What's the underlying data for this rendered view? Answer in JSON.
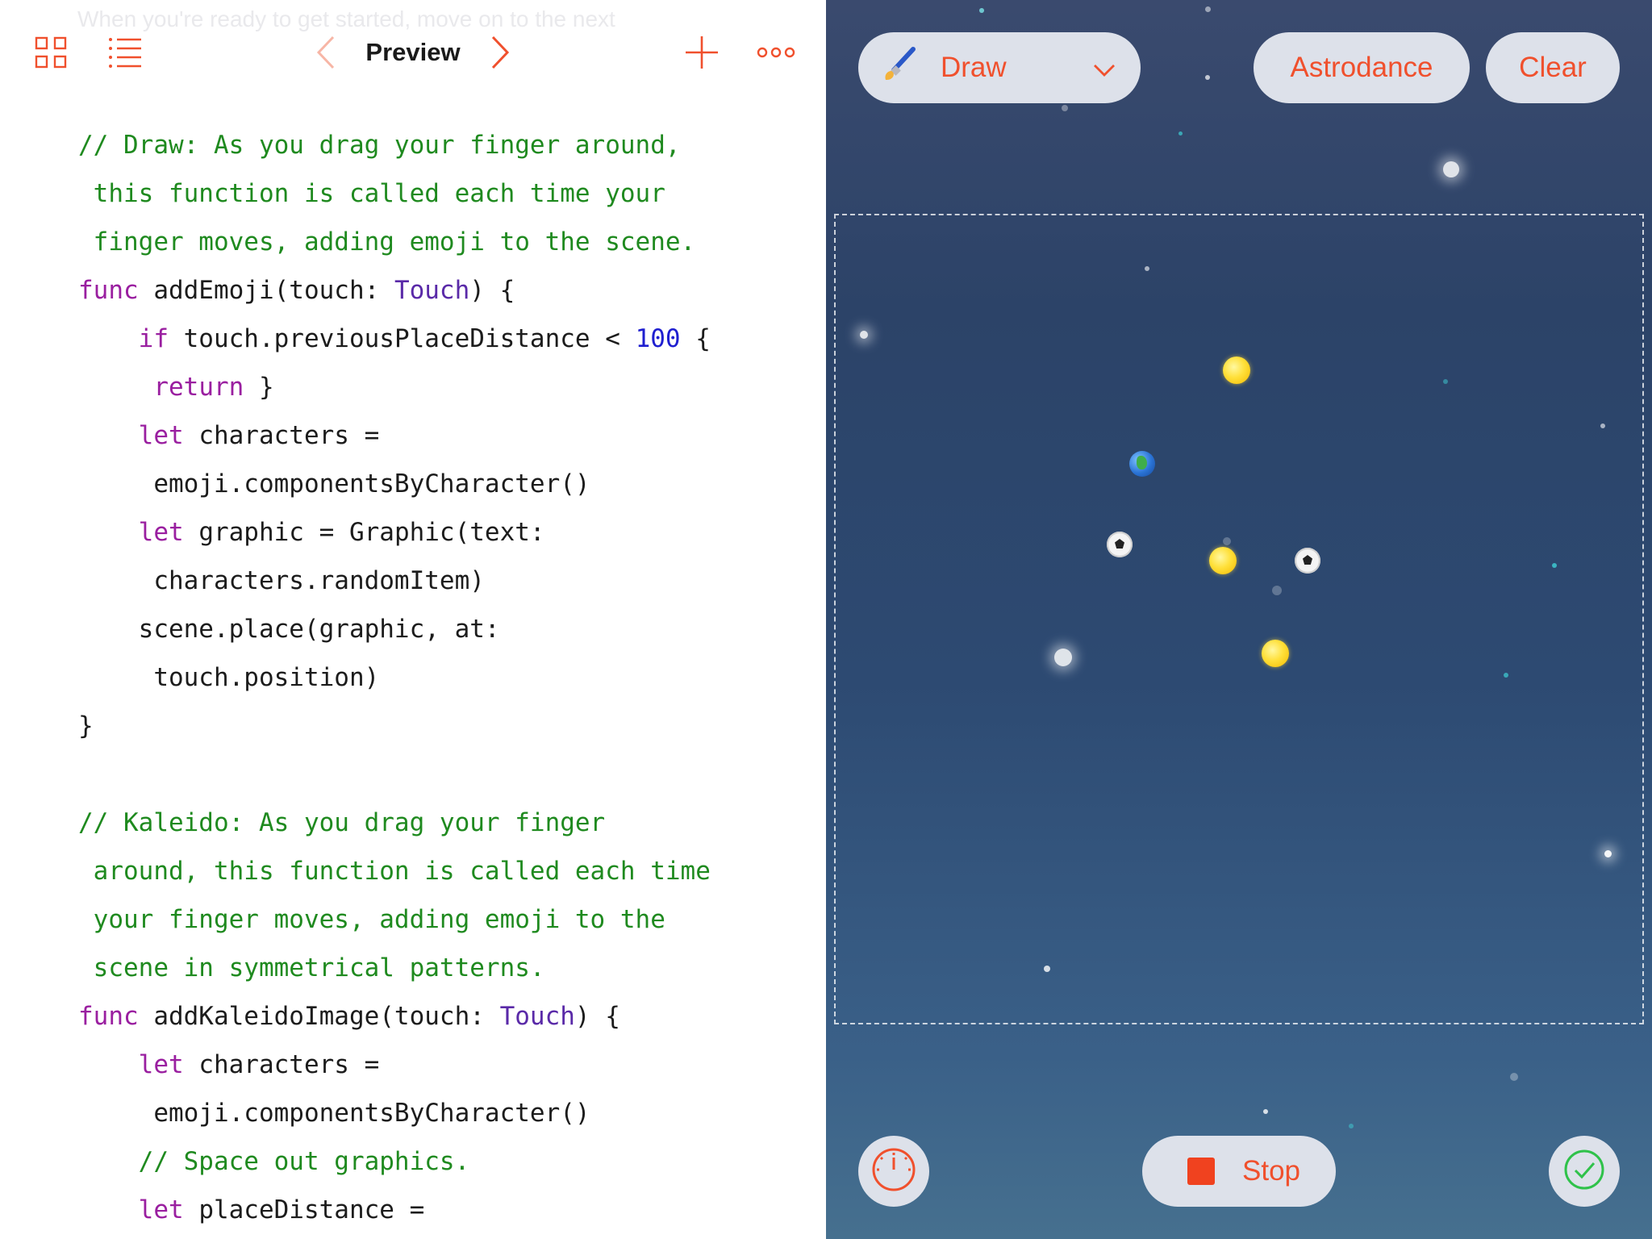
{
  "editor": {
    "faded_prose": "When you're ready to get started, move on to the next",
    "toolbar": {
      "title": "Preview",
      "icons": [
        "grid-icon",
        "list-icon",
        "chevron-left-icon",
        "chevron-right-icon",
        "plus-icon",
        "more-icon"
      ]
    },
    "code_lines": [
      [
        {
          "t": "// Draw: As you drag your finger around,",
          "c": "cm"
        }
      ],
      [
        {
          "t": " this function is called each time your",
          "c": "cm"
        }
      ],
      [
        {
          "t": " finger moves, adding emoji to the scene.",
          "c": "cm"
        }
      ],
      [
        {
          "t": "func",
          "c": "kw"
        },
        {
          "t": " addEmoji(touch: ",
          "c": ""
        },
        {
          "t": "Touch",
          "c": "ty"
        },
        {
          "t": ") {",
          "c": ""
        }
      ],
      [
        {
          "t": "    ",
          "c": ""
        },
        {
          "t": "if",
          "c": "kw"
        },
        {
          "t": " touch.previousPlaceDistance < ",
          "c": ""
        },
        {
          "t": "100",
          "c": "nm"
        },
        {
          "t": " {",
          "c": ""
        }
      ],
      [
        {
          "t": "     ",
          "c": ""
        },
        {
          "t": "return",
          "c": "kw"
        },
        {
          "t": " }",
          "c": ""
        }
      ],
      [
        {
          "t": "    ",
          "c": ""
        },
        {
          "t": "let",
          "c": "kw"
        },
        {
          "t": " characters =",
          "c": ""
        }
      ],
      [
        {
          "t": "     emoji.componentsByCharacter()",
          "c": ""
        }
      ],
      [
        {
          "t": "    ",
          "c": ""
        },
        {
          "t": "let",
          "c": "kw"
        },
        {
          "t": " graphic = Graphic(text:",
          "c": ""
        }
      ],
      [
        {
          "t": "     characters.randomItem)",
          "c": ""
        }
      ],
      [
        {
          "t": "    scene.place(graphic, at:",
          "c": ""
        }
      ],
      [
        {
          "t": "     touch.position)",
          "c": ""
        }
      ],
      [
        {
          "t": "}",
          "c": ""
        }
      ],
      [
        {
          "t": "",
          "c": ""
        }
      ],
      [
        {
          "t": "// Kaleido: As you drag your finger",
          "c": "cm"
        }
      ],
      [
        {
          "t": " around, this function is called each time",
          "c": "cm"
        }
      ],
      [
        {
          "t": " your finger moves, adding emoji to the",
          "c": "cm"
        }
      ],
      [
        {
          "t": " scene in symmetrical patterns.",
          "c": "cm"
        }
      ],
      [
        {
          "t": "func",
          "c": "kw"
        },
        {
          "t": " addKaleidoImage(touch: ",
          "c": ""
        },
        {
          "t": "Touch",
          "c": "ty"
        },
        {
          "t": ") {",
          "c": ""
        }
      ],
      [
        {
          "t": "    ",
          "c": ""
        },
        {
          "t": "let",
          "c": "kw"
        },
        {
          "t": " characters =",
          "c": ""
        }
      ],
      [
        {
          "t": "     emoji.componentsByCharacter()",
          "c": ""
        }
      ],
      [
        {
          "t": "    ",
          "c": ""
        },
        {
          "t": "// Space out graphics.",
          "c": "cm"
        }
      ],
      [
        {
          "t": "    ",
          "c": ""
        },
        {
          "t": "let",
          "c": "kw"
        },
        {
          "t": " placeDistance =",
          "c": ""
        }
      ]
    ]
  },
  "liveview": {
    "mode_button": {
      "label": "Draw",
      "icon": "paintbrush-icon",
      "chevron": "chevron-down-icon"
    },
    "astrodance_label": "Astrodance",
    "clear_label": "Clear",
    "stop_label": "Stop",
    "speed_icon": "speedometer-icon",
    "done_icon": "checkmark-circle-icon",
    "emoji_in_scene": [
      "sun-emoji",
      "globe-emoji",
      "soccer-ball-emoji",
      "sun-emoji",
      "soccer-ball-emoji",
      "sun-emoji"
    ]
  },
  "colors": {
    "accent": "#f0502d",
    "comment": "#1f8a1f",
    "keyword": "#9a1fa0",
    "type": "#5a2aa8",
    "number": "#1f1fd0",
    "pill_bg": "#dde1ea",
    "stop_square": "#f0421f"
  }
}
